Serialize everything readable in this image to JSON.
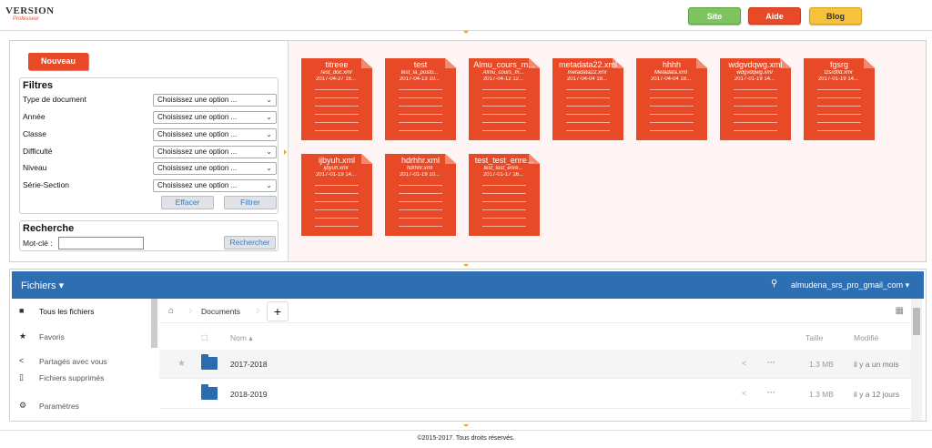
{
  "header": {
    "logo_main": "VERSION",
    "logo_sub": "Professeur",
    "buttons": {
      "site": "Site",
      "aide": "Aide",
      "blog": "Blog"
    }
  },
  "left": {
    "nouveau": "Nouveau",
    "filtres_title": "Filtres",
    "filters": [
      {
        "label": "Type de document",
        "value": "Choisissez une option ..."
      },
      {
        "label": "Année",
        "value": "Choisissez une option ..."
      },
      {
        "label": "Classe",
        "value": "Choisissez une option ..."
      },
      {
        "label": "Difficulté",
        "value": "Choisissez une option ..."
      },
      {
        "label": "Niveau",
        "value": "Choisissez une option ..."
      },
      {
        "label": "Série-Section",
        "value": "Choisissez une option ..."
      }
    ],
    "effacer": "Effacer",
    "filtrer": "Filtrer",
    "recherche_title": "Recherche",
    "motcle_label": "Mot-clé :",
    "motcle_value": "",
    "rechercher": "Rechercher"
  },
  "documents": [
    {
      "title": "titreee",
      "file": "Test_doc.xml",
      "date": "2017-04-27 16..."
    },
    {
      "title": "test",
      "file": "test_la_posto...",
      "date": "2017-04-13 10..."
    },
    {
      "title": "Almu_cours_m...",
      "file": "Almu_cours_m...",
      "date": "2017-04-12 12..."
    },
    {
      "title": "metadata22.xml",
      "file": "metadata22.xml",
      "date": "2017-04-04 18..."
    },
    {
      "title": "hhhh",
      "file": "Metadata.xml",
      "date": "2017-04-04 18..."
    },
    {
      "title": "wdgvdqwg.xml",
      "file": "wdgvdqwg.xml",
      "date": "2017-01-19 14..."
    },
    {
      "title": "fgsrg",
      "file": "tzsrdffd.xml",
      "date": "2017-01-19 14..."
    },
    {
      "title": "ijbyuh.xml",
      "file": "ijbyuh.xml",
      "date": "2017-01-19 14..."
    },
    {
      "title": "hdrhhr.xml",
      "file": "hdrhhr.xml",
      "date": "2017-01-19 10..."
    },
    {
      "title": "test_test_enre...",
      "file": "test_test_enre...",
      "date": "2017-01-17 16..."
    }
  ],
  "files": {
    "app_title": "Fichiers",
    "user": "almudena_srs_pro_gmail_com",
    "sidebar": [
      "Tous les fichiers",
      "Favoris",
      "Partagés avec vous",
      "Fichiers supprimés",
      "Paramètres"
    ],
    "breadcrumb": "Documents",
    "plus": "+",
    "columns": {
      "name": "Nom",
      "size": "Taille",
      "modified": "Modifié"
    },
    "rows": [
      {
        "name": "2017-2018",
        "size": "1.3 MB",
        "modified": "il y a un mois"
      },
      {
        "name": "2018-2019",
        "size": "1.3 MB",
        "modified": "il y a 12 jours"
      }
    ]
  },
  "footer": "©2015-2017. Tous droits réservés."
}
